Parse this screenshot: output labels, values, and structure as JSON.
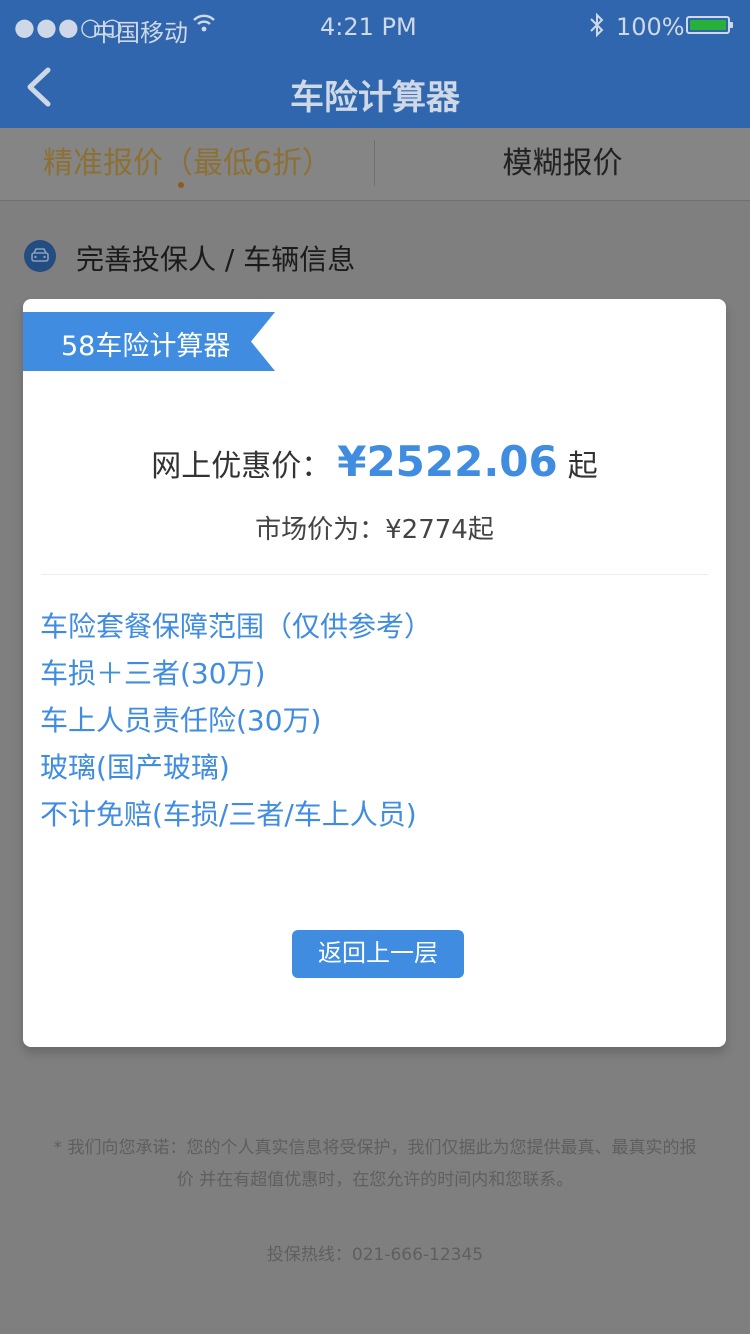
{
  "status_bar": {
    "signal": "●●●○○",
    "carrier": "中国移动",
    "time": "4:21 PM",
    "battery_pct": "100%",
    "battery_level": 1.0
  },
  "nav": {
    "title": "车险计算器",
    "back_icon": "chevron-left-icon"
  },
  "tabs": [
    {
      "label": "精准报价（最低6折）",
      "active": true
    },
    {
      "label": "模糊报价",
      "active": false
    }
  ],
  "info_row": {
    "icon": "car-icon",
    "text": "完善投保人 / 车辆信息"
  },
  "modal": {
    "ribbon_title": "58车险计算器",
    "price_label": "网上优惠价：",
    "price_value": "¥2522.06",
    "price_suffix": "起",
    "market_price": "市场价为：¥2774起",
    "coverage": [
      "车险套餐保障范围（仅供参考）",
      "车损＋三者(30万)",
      "车上人员责任险(30万)",
      "玻璃(国产玻璃)",
      "不计免赔(车损/三者/车上人员)"
    ],
    "back_button": "返回上一层"
  },
  "footer": {
    "note": "* 我们向您承诺：您的个人真实信息将受保护，我们仅据此为您提供最真、最真实的报价 并在有超值优惠时，在您允许的时间内和您联系。",
    "hotline": "投保热线：021-666-12345"
  },
  "colors": {
    "nav_bg": "#2f66ad",
    "accent_blue": "#3f8ce0",
    "overlay": "#7f7f7f",
    "active_tab": "#8c7034"
  }
}
